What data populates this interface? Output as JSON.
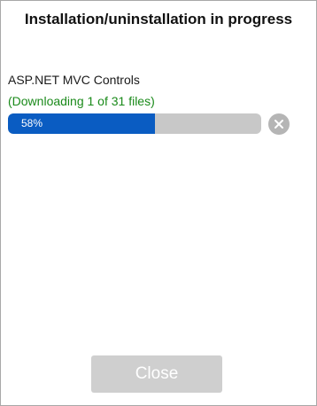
{
  "dialog": {
    "title": "Installation/uninstallation in progress"
  },
  "item": {
    "name": "ASP.NET MVC Controls",
    "status": "(Downloading 1 of 31 files)",
    "progress_percent": 58,
    "progress_label": "58%"
  },
  "cancel_icon": "close-circle-icon",
  "footer": {
    "close_label": "Close"
  },
  "colors": {
    "status_text": "#1a8a1a",
    "progress_fill": "#0a5cc2",
    "progress_track": "#c8c8c8",
    "button_disabled": "#cfcfcf"
  }
}
